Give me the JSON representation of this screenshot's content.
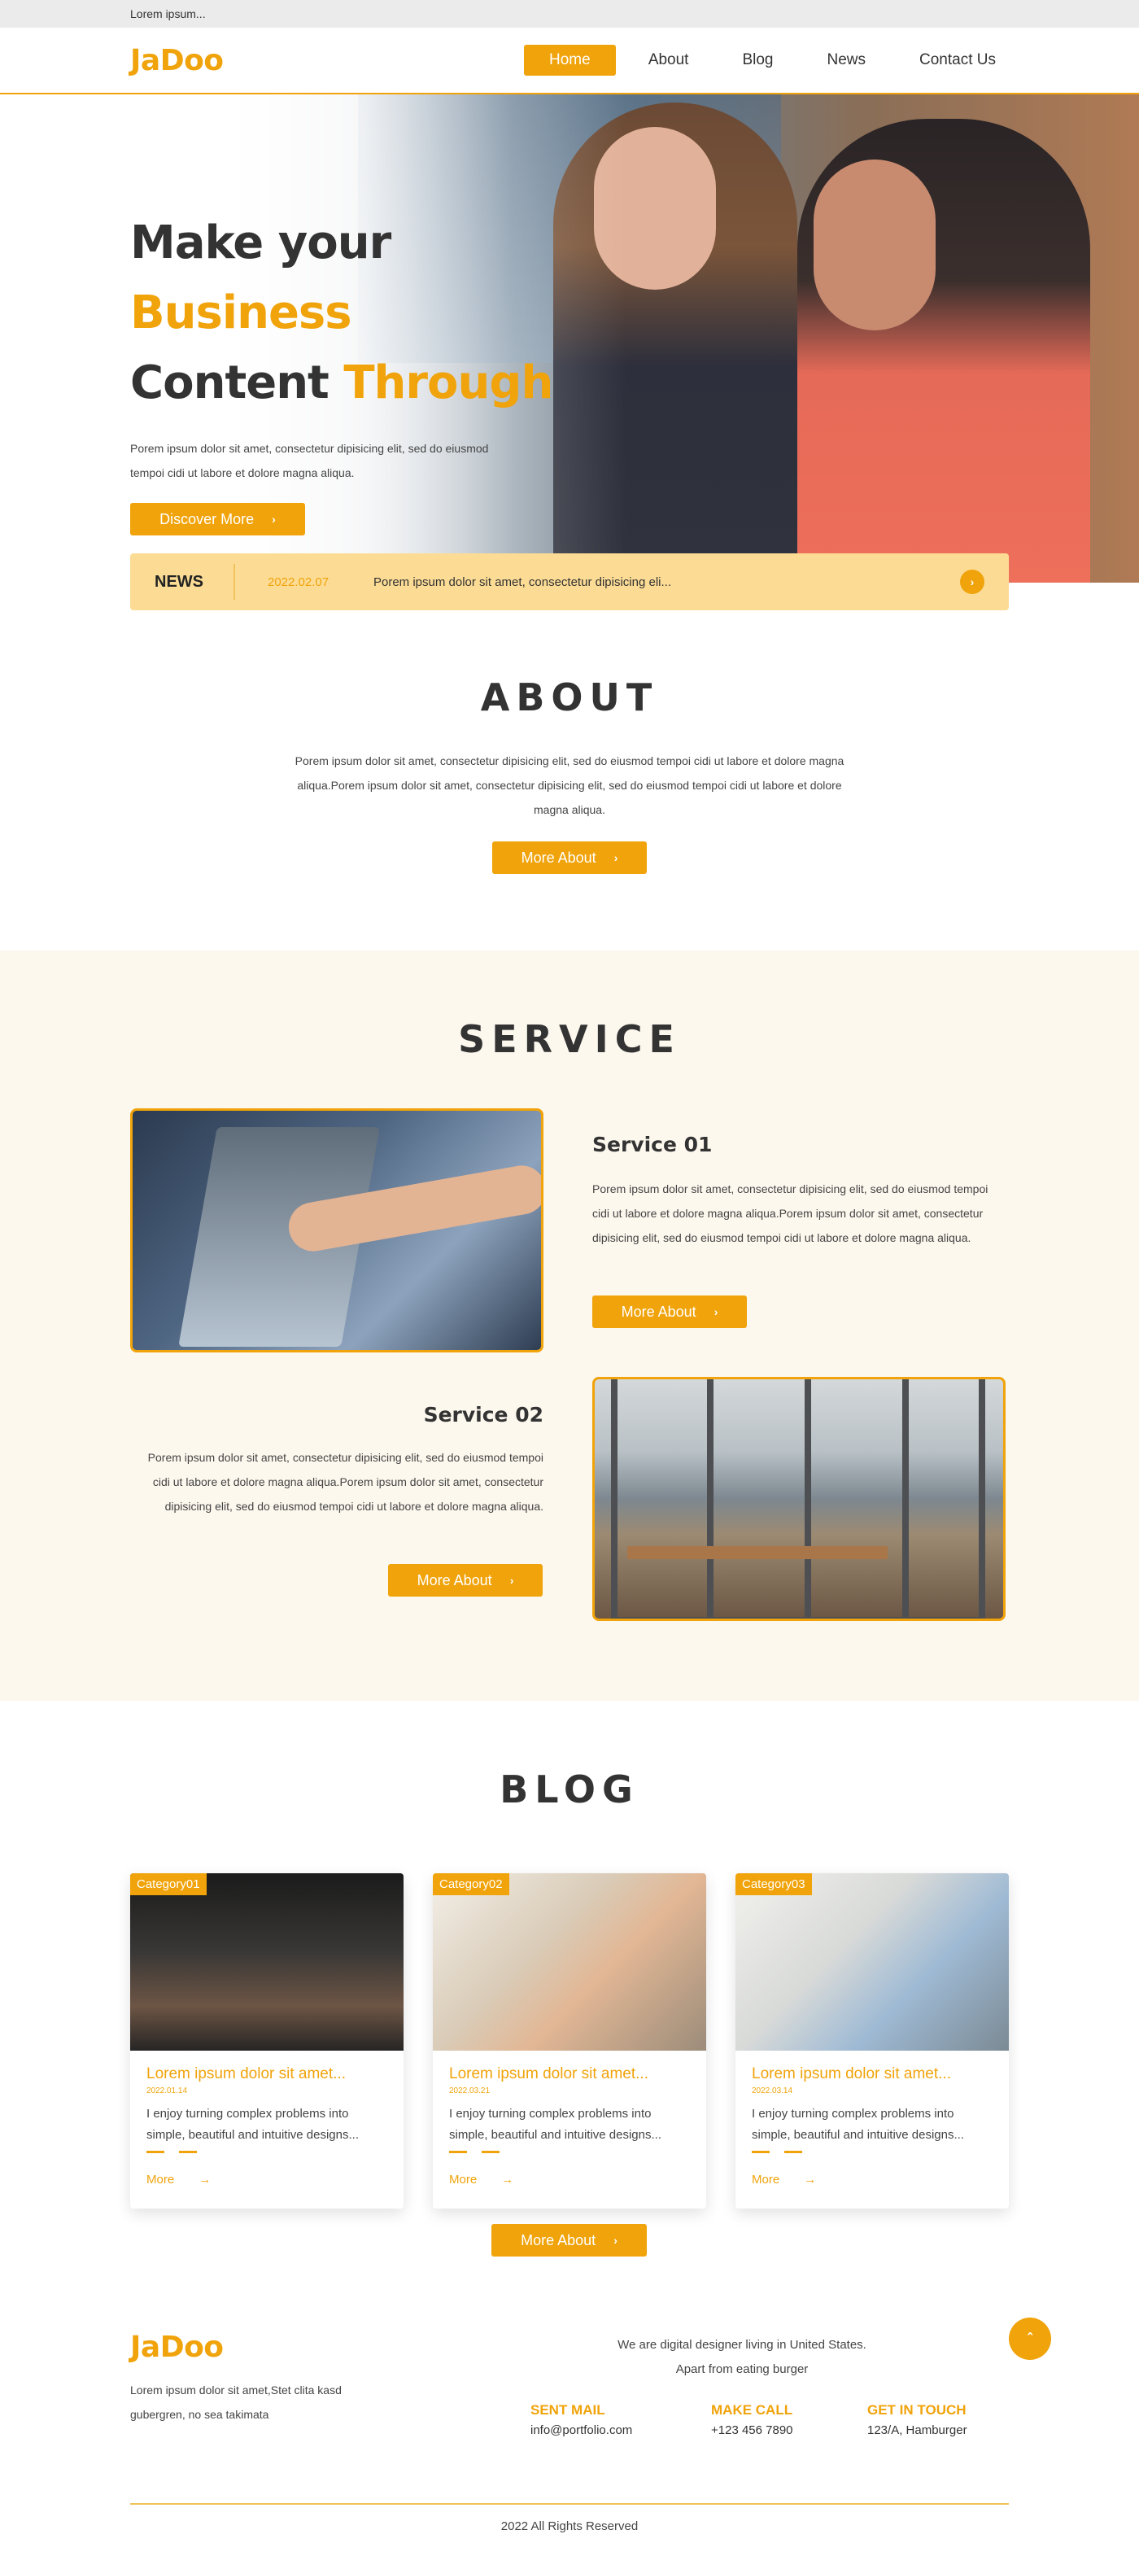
{
  "topbar": {
    "text": "Lorem ipsum..."
  },
  "header": {
    "logo": "JaDoo",
    "nav": [
      "Home",
      "About",
      "Blog",
      "News",
      "Contact Us"
    ]
  },
  "hero": {
    "title_line1": "Make your ",
    "title_line1_hl": "Business",
    "title_line2": "Content ",
    "title_line2_hl": "Through",
    "description": "Porem ipsum dolor sit amet, consectetur dipisicing elit, sed do eiusmod tempoi cidi ut labore et dolore magna aliqua.",
    "button": "Discover More",
    "button_icon": "chevron-right-icon"
  },
  "news": {
    "label": "NEWS",
    "date": "2022.02.07",
    "text": "Porem ipsum dolor sit amet, consectetur dipisicing eli...",
    "arrow_icon": "chevron-right-icon"
  },
  "about": {
    "title": "ABOUT",
    "text": "Porem ipsum dolor sit amet, consectetur dipisicing elit, sed do eiusmod tempoi cidi ut labore et dolore magna aliqua.Porem ipsum dolor sit amet, consectetur dipisicing elit, sed do eiusmod tempoi cidi ut labore et dolore magna aliqua.",
    "button": "More About"
  },
  "service": {
    "title": "SERVICE",
    "items": [
      {
        "title": "Service 01",
        "text": "Porem ipsum dolor sit amet, consectetur dipisicing elit, sed do eiusmod tempoi cidi ut labore et dolore magna aliqua.Porem ipsum dolor sit amet, consectetur dipisicing elit, sed do eiusmod tempoi cidi ut labore et dolore magna aliqua.",
        "button": "More About"
      },
      {
        "title": "Service 02",
        "text": "Porem ipsum dolor sit amet, consectetur dipisicing elit, sed do eiusmod tempoi cidi ut labore et dolore magna aliqua.Porem ipsum dolor sit amet, consectetur dipisicing elit, sed do eiusmod tempoi cidi ut labore et dolore magna aliqua.",
        "button": "More About"
      }
    ]
  },
  "blog": {
    "title": "BLOG",
    "cards": [
      {
        "category": "Category01",
        "title": "Lorem ipsum dolor sit amet...",
        "date": "2022.01.14",
        "text": "I enjoy turning complex problems into simple, beautiful and intuitive designs...",
        "more": "More",
        "arrow": "→"
      },
      {
        "category": "Category02",
        "title": "Lorem ipsum dolor sit amet...",
        "date": "2022.03.21",
        "text": "I enjoy turning complex problems into simple, beautiful and intuitive designs...",
        "more": "More",
        "arrow": "→"
      },
      {
        "category": "Category03",
        "title": "Lorem ipsum dolor sit amet...",
        "date": "2022.03.14",
        "text": "I enjoy turning complex problems into simple, beautiful and intuitive designs...",
        "more": "More",
        "arrow": "→"
      }
    ],
    "button": "More About"
  },
  "footer": {
    "logo": "JaDoo",
    "left_text": "Lorem ipsum dolor sit amet,Stet clita kasd gubergren, no sea takimata",
    "tagline_1": "We are digital designer living in United States.",
    "tagline_2": "Apart from eating burger",
    "columns": [
      {
        "heading": "SENT MAIL",
        "value": "info@portfolio.com"
      },
      {
        "heading": "MAKE CALL",
        "value": "+123 456 7890"
      },
      {
        "heading": "GET IN TOUCH",
        "value": "123/A, Hamburger"
      }
    ],
    "scroll_up_icon": "chevron-up-icon",
    "copyright": "2022 All Rights Reserved"
  },
  "colors": {
    "accent": "#f0a30a",
    "news_bg": "#fcdc95",
    "service_bg": "#fdf8ee"
  }
}
